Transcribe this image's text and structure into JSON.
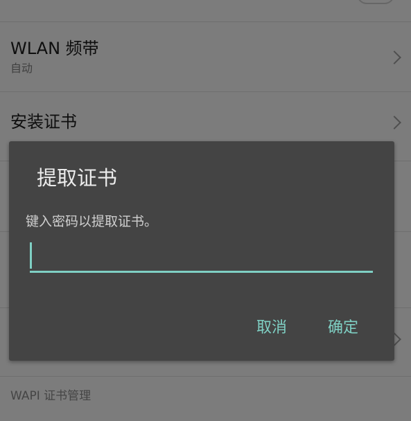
{
  "settings": {
    "wlan_band": {
      "title": "WLAN 频带",
      "value": "自动"
    },
    "install_certificate": {
      "title": "安装证书"
    },
    "wapi_section_header": "WAPI 证书管理"
  },
  "dialog": {
    "title": "提取证书",
    "message": "键入密码以提取证书。",
    "password_value": "",
    "cancel_label": "取消",
    "confirm_label": "确定"
  },
  "colors": {
    "accent": "#7fd0c4",
    "dialog_background": "#444444",
    "scrim_background": "#7c7c7c"
  }
}
